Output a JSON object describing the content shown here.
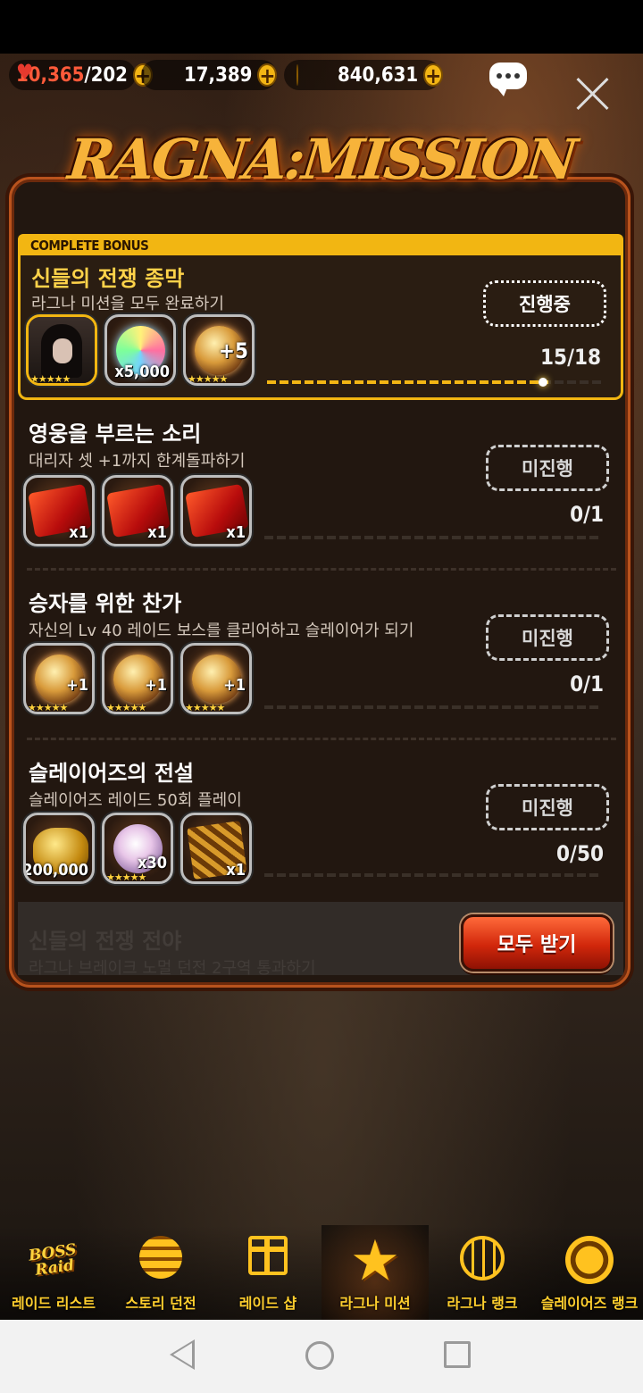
{
  "currency": {
    "stamina": "10,365",
    "stamina_max": "/202",
    "gems": "17,389",
    "gold": "840,631",
    "plus_symbol": "+"
  },
  "header": {
    "title": "RAGNA:MISSION"
  },
  "complete_bonus": {
    "ribbon": "COMPLETE BONUS",
    "title": "신들의 전쟁 종막",
    "desc": "라그나 미션을 모두 완료하기",
    "status": "진행중",
    "progress": "15/18",
    "progress_fraction": 0.833,
    "rewards": [
      {
        "icon": "hero-portrait",
        "qty": "",
        "stars": "★★★★★"
      },
      {
        "icon": "rainbow-gem",
        "qty": "x5,000",
        "stars": ""
      },
      {
        "icon": "limit-break-orb",
        "qty": "+5",
        "stars": "★★★★★"
      }
    ]
  },
  "missions": [
    {
      "title": "영웅을 부르는 소리",
      "desc": "대리자 셋 +1까지 한계돌파하기",
      "status": "미진행",
      "progress": "0/1",
      "progress_fraction": 0,
      "rewards": [
        {
          "icon": "summon-ticket",
          "qty": "x1",
          "stars": ""
        },
        {
          "icon": "summon-ticket",
          "qty": "x1",
          "stars": ""
        },
        {
          "icon": "summon-ticket",
          "qty": "x1",
          "stars": ""
        }
      ]
    },
    {
      "title": "승자를 위한 찬가",
      "desc": "자신의 Lv 40 레이드 보스를 클리어하고 슬레이어가 되기",
      "status": "미진행",
      "progress": "0/1",
      "progress_fraction": 0,
      "rewards": [
        {
          "icon": "limit-break-orb",
          "qty": "+1",
          "stars": "★★★★★"
        },
        {
          "icon": "limit-break-orb",
          "qty": "+1",
          "stars": "★★★★★"
        },
        {
          "icon": "limit-break-orb",
          "qty": "+1",
          "stars": "★★★★★"
        }
      ]
    },
    {
      "title": "슬레이어즈의 전설",
      "desc": "슬레이어즈 레이드 50회 플레이",
      "status": "미진행",
      "progress": "0/50",
      "progress_fraction": 0,
      "rewards": [
        {
          "icon": "gold-coins",
          "qty": "x200,000",
          "stars": ""
        },
        {
          "icon": "diamond",
          "qty": "x30",
          "stars": "★★★★★"
        },
        {
          "icon": "gold-card",
          "qty": "x1",
          "stars": ""
        }
      ]
    }
  ],
  "faded_mission": {
    "title": "신들의 전쟁 전야",
    "desc": "라그나 브레이크 노멀 던전 2구역 통과하기"
  },
  "receive_all": "모두 받기",
  "bottom_nav": [
    {
      "label": "레이드 리스트",
      "icon_text": "BOSS\nRaid"
    },
    {
      "label": "스토리 던전"
    },
    {
      "label": "레이드 샵"
    },
    {
      "label": "라그나 미션",
      "icon_text": "★"
    },
    {
      "label": "라그나 랭크"
    },
    {
      "label": "슬레이어즈 랭크"
    }
  ]
}
